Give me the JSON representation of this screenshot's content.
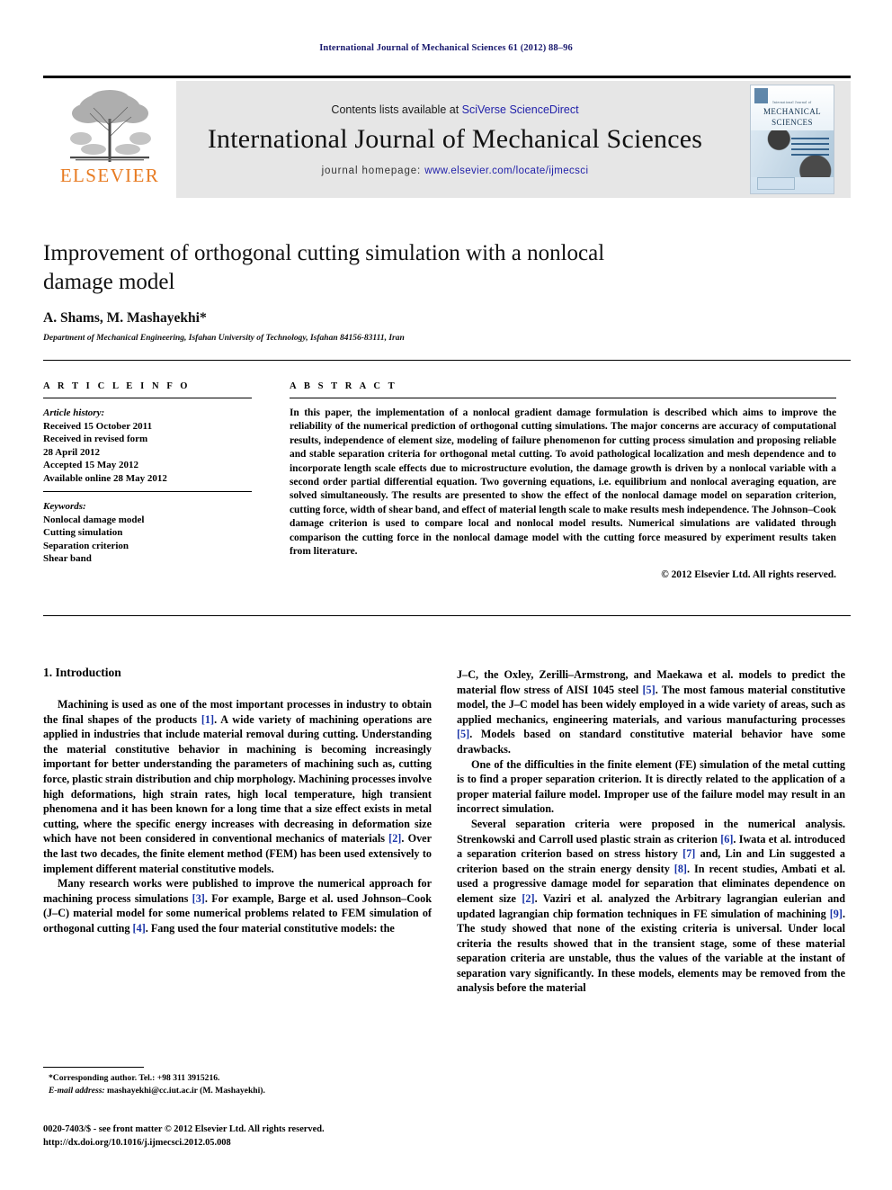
{
  "running_head": "International Journal of Mechanical Sciences 61 (2012) 88–96",
  "masthead": {
    "publisher_wordmark": "ELSEVIER",
    "contents_prefix": "Contents lists available at ",
    "contents_link": "SciVerse ScienceDirect",
    "journal_name": "International Journal of Mechanical Sciences",
    "homepage_prefix": "journal homepage: ",
    "homepage_link": "www.elsevier.com/locate/ijmecsci",
    "cover": {
      "line1": "International Journal of",
      "line2": "MECHANICAL",
      "line3": "SCIENCES"
    }
  },
  "article": {
    "title": "Improvement of orthogonal cutting simulation with a nonlocal damage model",
    "authors": "A. Shams, M. Mashayekhi*",
    "affiliation": "Department of Mechanical Engineering, Isfahan University of Technology, Isfahan 84156-83111, Iran"
  },
  "info": {
    "heading": "A R T I C L E   I N F O",
    "history_label": "Article history:",
    "history": [
      "Received 15 October 2011",
      "Received in revised form",
      "28 April 2012",
      "Accepted 15 May 2012",
      "Available online 28 May 2012"
    ],
    "keywords_label": "Keywords:",
    "keywords": [
      "Nonlocal damage model",
      "Cutting simulation",
      "Separation criterion",
      "Shear band"
    ]
  },
  "abstract": {
    "heading": "A B S T R A C T",
    "text": "In this paper, the implementation of a nonlocal gradient damage formulation is described which aims to improve the reliability of the numerical prediction of orthogonal cutting simulations. The major concerns are accuracy of computational results, independence of element size, modeling of failure phenomenon for cutting process simulation and proposing reliable and stable separation criteria for orthogonal metal cutting. To avoid pathological localization and mesh dependence and to incorporate length scale effects due to microstructure evolution, the damage growth is driven by a nonlocal variable with a second order partial differential equation. Two governing equations, i.e. equilibrium and nonlocal averaging equation, are solved simultaneously. The results are presented to show the effect of the nonlocal damage model on separation criterion, cutting force, width of shear band, and effect of material length scale to make results mesh independence. The Johnson–Cook damage criterion is used to compare local and nonlocal model results. Numerical simulations are validated through comparison the cutting force in the nonlocal damage model with the cutting force measured by experiment results taken from literature.",
    "copyright": "© 2012 Elsevier Ltd. All rights reserved."
  },
  "section": {
    "heading": "1.  Introduction"
  },
  "body": {
    "left": [
      "Machining is used as one of the most important processes in industry to obtain the final shapes of the products [1]. A wide variety of machining operations are applied in industries that include material removal during cutting. Understanding the material constitutive behavior in machining is becoming increasingly important for better understanding the parameters of machining such as, cutting force, plastic strain distribution and chip morphology. Machining processes involve high deformations, high strain rates, high local temperature, high transient phenomena and it has been known for a long time that a size effect exists in metal cutting, where the specific energy increases with decreasing in deformation size which have not been considered in conventional mechanics of materials [2]. Over the last two decades, the finite element method (FEM) has been used extensively to implement different material constitutive models.",
      "Many research works were published to improve the numerical approach for machining process simulations [3]. For example, Barge et al. used Johnson–Cook (J–C) material model for some numerical problems related to FEM simulation of orthogonal cutting [4]. Fang used the four material constitutive models: the"
    ],
    "right": [
      "J–C, the Oxley, Zerilli–Armstrong, and Maekawa et al. models to predict the material flow stress of AISI 1045 steel [5]. The most famous material constitutive model, the J–C model has been widely employed in a wide variety of areas, such as applied mechanics, engineering materials, and various manufacturing processes [5]. Models based on standard constitutive material behavior have some drawbacks.",
      "One of the difficulties in the finite element (FE) simulation of the metal cutting is to find a proper separation criterion. It is directly related to the application of a proper material failure model. Improper use of the failure model may result in an incorrect simulation.",
      "Several separation criteria were proposed in the numerical analysis. Strenkowski and Carroll used plastic strain as criterion [6]. Iwata et al. introduced a separation criterion based on stress history [7] and, Lin and Lin suggested a criterion based on the strain energy density [8]. In recent studies, Ambati et al. used a progressive damage model for separation that eliminates dependence on element size [2]. Vaziri et al. analyzed the Arbitrary lagrangian eulerian and updated lagrangian chip formation techniques in FE simulation of machining [9]. The study showed that none of the existing criteria is universal. Under local criteria the results showed that in the transient stage, some of these material separation criteria are unstable, thus the values of the variable at the instant of separation vary significantly. In these models, elements may be removed from the analysis before the material"
    ]
  },
  "footnote": {
    "corresponding": "*Corresponding author. Tel.: +98 311 3915216.",
    "email_label": "E-mail address:",
    "email": " mashayekhi@cc.iut.ac.ir (M. Mashayekhi)."
  },
  "imprint": {
    "line1": "0020-7403/$ - see front matter © 2012 Elsevier Ltd. All rights reserved.",
    "line2": "http://dx.doi.org/10.1016/j.ijmecsci.2012.05.008"
  },
  "colors": {
    "running_head": "#1a1a6e",
    "link": "#2222aa",
    "reference": "#1a34a8",
    "elsevier_orange": "#E77B22",
    "band_bg": "#e6e6e6"
  }
}
